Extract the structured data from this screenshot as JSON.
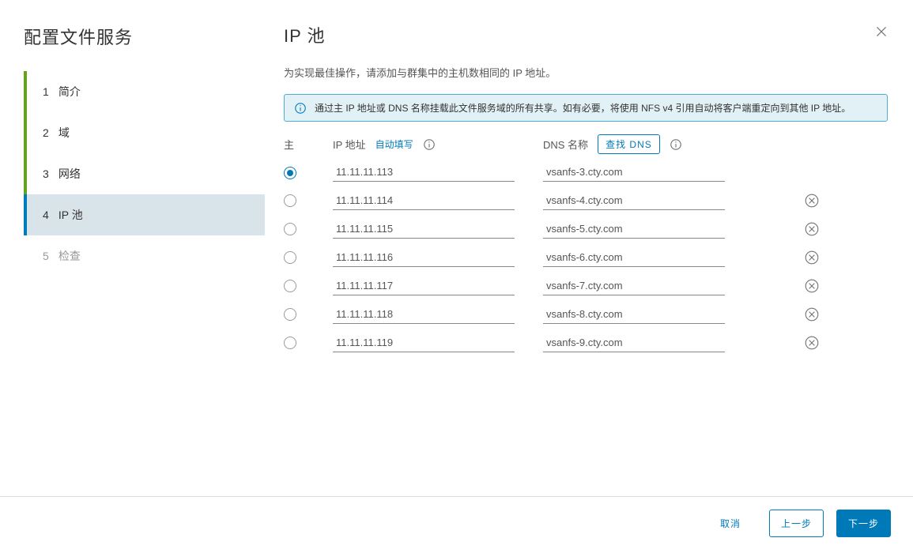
{
  "wizard": {
    "title": "配置文件服务",
    "steps": [
      {
        "num": "1",
        "label": "简介",
        "state": "done"
      },
      {
        "num": "2",
        "label": "域",
        "state": "done"
      },
      {
        "num": "3",
        "label": "网络",
        "state": "done"
      },
      {
        "num": "4",
        "label": "IP 池",
        "state": "active"
      },
      {
        "num": "5",
        "label": "检查",
        "state": "disabled"
      }
    ]
  },
  "page": {
    "title": "IP 池",
    "desc": "为实现最佳操作，请添加与群集中的主机数相同的 IP 地址。",
    "banner": "通过主 IP 地址或 DNS 名称挂载此文件服务域的所有共享。如有必要，将使用 NFS v4 引用自动将客户端重定向到其他 IP 地址。"
  },
  "columns": {
    "main": "主",
    "ip": "IP 地址",
    "autofill": "自动填写",
    "dns": "DNS 名称",
    "lookup": "查找 DNS"
  },
  "rows": [
    {
      "primary": true,
      "ip": "11.11.11.113",
      "dns": "vsanfs-3.cty.com"
    },
    {
      "primary": false,
      "ip": "11.11.11.114",
      "dns": "vsanfs-4.cty.com"
    },
    {
      "primary": false,
      "ip": "11.11.11.115",
      "dns": "vsanfs-5.cty.com"
    },
    {
      "primary": false,
      "ip": "11.11.11.116",
      "dns": "vsanfs-6.cty.com"
    },
    {
      "primary": false,
      "ip": "11.11.11.117",
      "dns": "vsanfs-7.cty.com"
    },
    {
      "primary": false,
      "ip": "11.11.11.118",
      "dns": "vsanfs-8.cty.com"
    },
    {
      "primary": false,
      "ip": "11.11.11.119",
      "dns": "vsanfs-9.cty.com"
    }
  ],
  "footer": {
    "cancel": "取消",
    "back": "上一步",
    "next": "下一步"
  }
}
